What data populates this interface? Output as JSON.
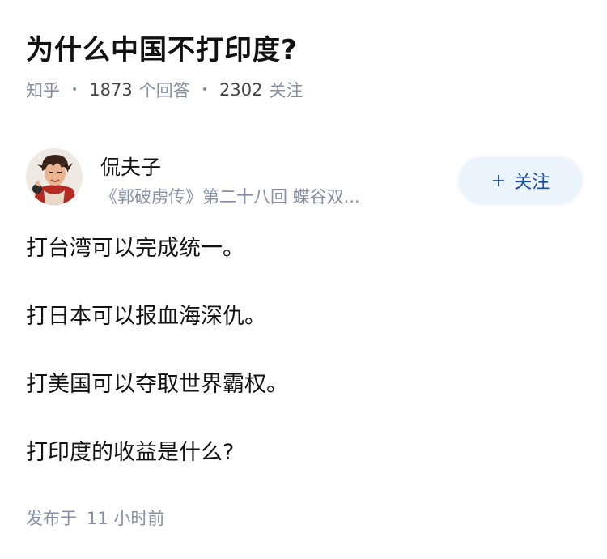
{
  "question": {
    "title": "为什么中国不打印度?",
    "source": "知乎",
    "answer_count": "1873",
    "answer_label": "个回答",
    "follower_count": "2302",
    "follower_label": "关注"
  },
  "author": {
    "name": "侃夫子",
    "headline": "《郭破虏传》第二十八回 蝶谷双...",
    "follow_icon": "+",
    "follow_label": "关注"
  },
  "answer": {
    "paragraphs": [
      "打台湾可以完成统一。",
      "打日本可以报血海深仇。",
      "打美国可以夺取世界霸权。",
      "打印度的收益是什么?"
    ]
  },
  "footer": {
    "published_label": "发布于",
    "published_time": "11 小时前"
  },
  "colors": {
    "follow_bg": "#ebf3fd",
    "follow_text": "#1f4e9c",
    "meta_text": "#8590a6"
  }
}
